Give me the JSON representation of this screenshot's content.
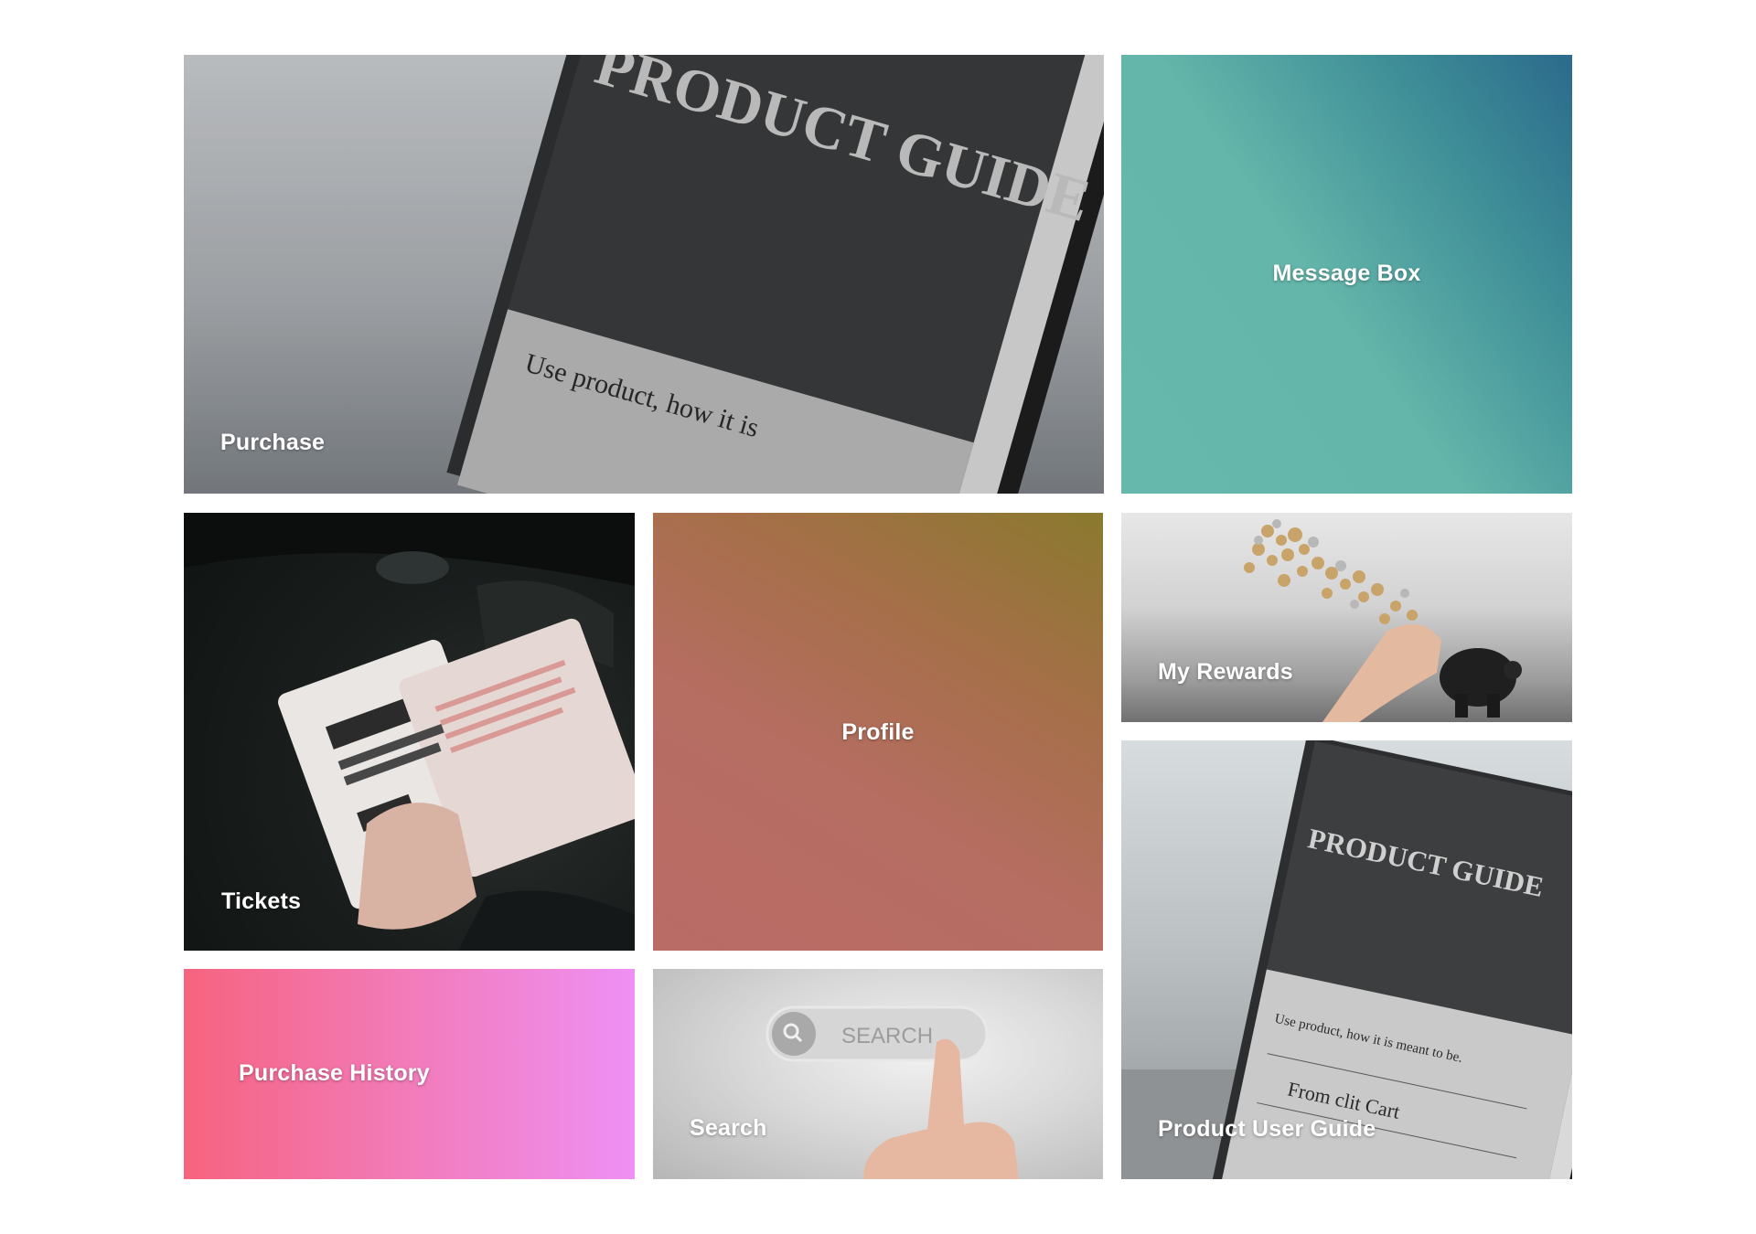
{
  "tiles": {
    "purchase": {
      "label": "Purchase",
      "book_title": "PRODUCT GUIDE",
      "book_subtitle": "Use product, how it is"
    },
    "message_box": {
      "label": "Message Box"
    },
    "tickets": {
      "label": "Tickets"
    },
    "profile": {
      "label": "Profile"
    },
    "my_rewards": {
      "label": "My Rewards"
    },
    "product_user_guide": {
      "label": "Product User Guide",
      "book_title": "PRODUCT GUIDE",
      "book_subtitle": "Use product, how it is meant to be.",
      "book_footer": "From clit Cart"
    },
    "purchase_history": {
      "label": "Purchase History"
    },
    "search": {
      "label": "Search",
      "search_placeholder": "SEARCH"
    }
  },
  "colors": {
    "message_box": "#66b8ad",
    "profile": "#b96b66",
    "purchase_history_start": "#f6637f",
    "purchase_history_end": "#ee90f4"
  }
}
